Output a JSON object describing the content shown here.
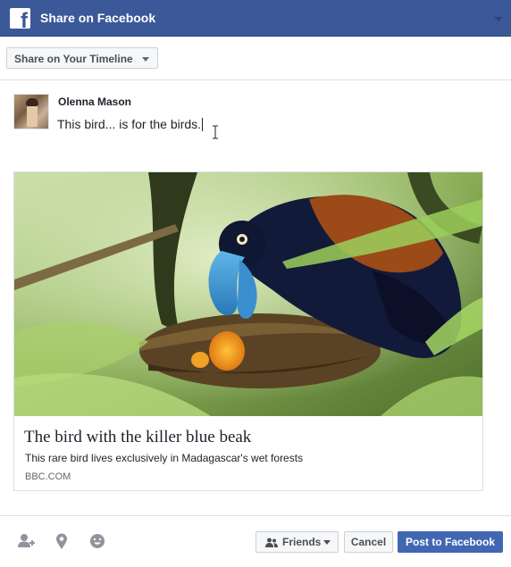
{
  "header": {
    "logo_letter": "f",
    "title": "Share on Facebook"
  },
  "share_target": {
    "label": "Share on Your Timeline"
  },
  "composer": {
    "user_name": "Olenna Mason",
    "text": "This bird... is for the birds."
  },
  "link_preview": {
    "title": "The bird with the killer blue beak",
    "description": "This rare bird lives exclusively in Madagascar's wet forests",
    "domain": "BBC.COM"
  },
  "footer": {
    "icons": [
      "tag-friends-icon",
      "location-icon",
      "feeling-icon"
    ],
    "audience_label": "Friends",
    "cancel_label": "Cancel",
    "post_label": "Post to Facebook"
  },
  "colors": {
    "brand": "#3b5998",
    "post_button": "#4267b2"
  }
}
